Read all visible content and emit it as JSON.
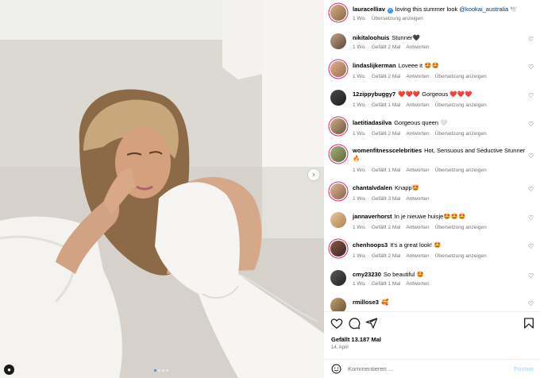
{
  "post": {
    "author": "lauracelliav",
    "caption_text": "loving this summer look",
    "caption_mention": "@kookai_australia",
    "caption_emoji": "🕊️",
    "time": "1 Wo.",
    "translate": "Übersetzung anzeigen"
  },
  "carousel": {
    "slide_count": 4,
    "active_index": 0
  },
  "comments": [
    {
      "user": "nikitaloohuis",
      "text": "Stunner🖤",
      "time": "1 Wo.",
      "likes": "Gefällt 2 Mal",
      "reply": "Antworten",
      "translate": ""
    },
    {
      "user": "lindaslijkerman",
      "text": "Loveee it 🤩🤩",
      "time": "1 Wo.",
      "likes": "Gefällt 2 Mal",
      "reply": "Antworten",
      "translate": "Übersetzung anzeigen"
    },
    {
      "user": "12zippybuggy7",
      "text": "❤️❤️❤️ Gorgeous ❤️❤️❤️",
      "time": "1 Wo.",
      "likes": "Gefällt 1 Mal",
      "reply": "Antworten",
      "translate": "Übersetzung anzeigen"
    },
    {
      "user": "laetitiadasilva",
      "text": "Gorgeous queen 🤍",
      "time": "1 Wo.",
      "likes": "Gefällt 2 Mal",
      "reply": "Antworten",
      "translate": "Übersetzung anzeigen"
    },
    {
      "user": "womenfitnesscelebrities",
      "text": "Hot, Sensuous and Seductive Stunner 🔥",
      "time": "1 Wo.",
      "likes": "Gefällt 1 Mal",
      "reply": "Antworten",
      "translate": "Übersetzung anzeigen"
    },
    {
      "user": "chantalvdalen",
      "text": "Knapp🤩",
      "time": "1 Wo.",
      "likes": "Gefällt 3 Mal",
      "reply": "Antworten",
      "translate": ""
    },
    {
      "user": "jannaverhorst",
      "text": "In je nieuwe huisje🤩🤩🤩",
      "time": "1 Wo.",
      "likes": "Gefällt 2 Mal",
      "reply": "Antworten",
      "translate": "Übersetzung anzeigen"
    },
    {
      "user": "chenhoops3",
      "text": "It's a great look! 🤩",
      "time": "1 Wo.",
      "likes": "Gefällt 2 Mal",
      "reply": "Antworten",
      "translate": "Übersetzung anzeigen"
    },
    {
      "user": "cmy23230",
      "text": "So beautiful 🤩",
      "time": "1 Wo.",
      "likes": "Gefällt 1 Mal",
      "reply": "Antworten",
      "translate": ""
    },
    {
      "user": "rmillose3",
      "text": "🥰",
      "time": "",
      "likes": "",
      "reply": "",
      "translate": ""
    }
  ],
  "actions": {
    "like_icon": "heart-icon",
    "comment_icon": "comment-icon",
    "share_icon": "paper-plane-icon",
    "save_icon": "bookmark-icon",
    "likes_text": "Gefällt 13.187 Mal",
    "date": "14. April"
  },
  "composer": {
    "placeholder": "Kommentieren ...",
    "post_label": "Posten",
    "emoji_icon": "smiley-icon"
  },
  "colors": {
    "link": "#00376b",
    "story_ring": "#d62976",
    "verified": "#3897f0",
    "post_disabled": "#b2dffc"
  }
}
